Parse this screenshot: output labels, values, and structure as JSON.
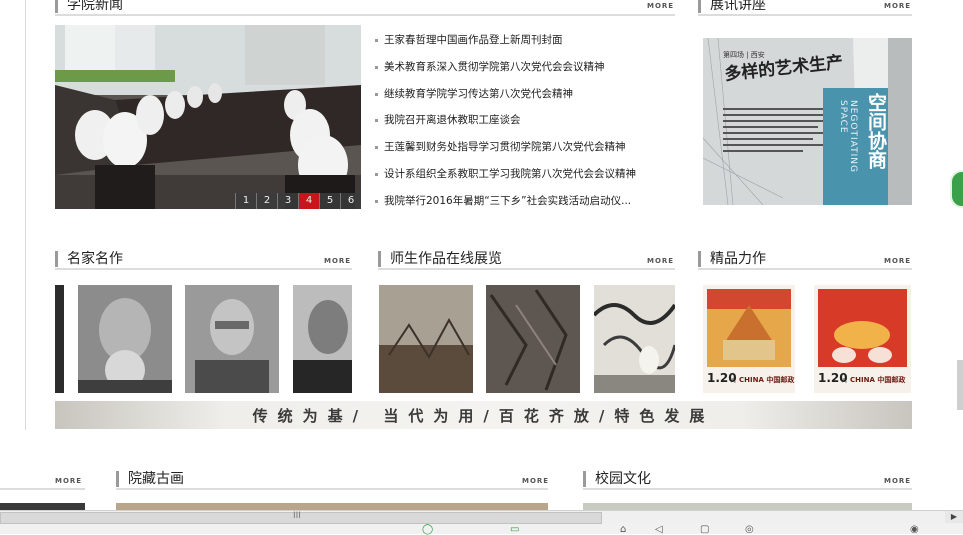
{
  "sections": {
    "news": {
      "title": "学院新闻",
      "more": "MORE"
    },
    "lectures": {
      "title": "展讯讲座",
      "more": "MORE"
    },
    "masters": {
      "title": "名家名作",
      "more": "MORE"
    },
    "works": {
      "title": "师生作品在线展览",
      "more": "MORE"
    },
    "boutique": {
      "title": "精品力作",
      "more": "MORE"
    },
    "left_bottom": {
      "more": "MORE"
    },
    "ancient": {
      "title": "院藏古画",
      "more": "MORE"
    },
    "campus": {
      "title": "校园文化",
      "more": "MORE"
    }
  },
  "news_list": [
    "王家春哲理中国画作品登上新周刊封面",
    "美术教育系深入贯彻学院第八次党代会会议精神",
    "继续教育学院学习传达第八次党代会精神",
    "我院召开离退休教职工座谈会",
    "王莲馨到财务处指导学习贯彻学院第八次党代会精神",
    "设计系组织全系教职工学习我院第八次党代会会议精神",
    "我院举行2016年暑期“三下乡”社会实践活动启动仪..."
  ],
  "slideshow": {
    "pages": [
      "1",
      "2",
      "3",
      "4",
      "5",
      "6"
    ],
    "active_index": 3
  },
  "poster": {
    "small": "第四场 | 西安",
    "title": "多样的艺术生产",
    "vertical": "空间协商",
    "en": "NEGOTIATING SPACE"
  },
  "stamps": [
    {
      "value": "1.20",
      "label": "CHINA 中国邮政",
      "unit": "元"
    },
    {
      "value": "1.20",
      "label": "CHINA 中国邮政",
      "unit": "元"
    }
  ],
  "banner": "传统为基/ 当代为用/百花齐放/特色发展",
  "scroll_grip": "III",
  "colors": {
    "accent_red": "#c8151b",
    "rule": "#dcdcdc"
  }
}
